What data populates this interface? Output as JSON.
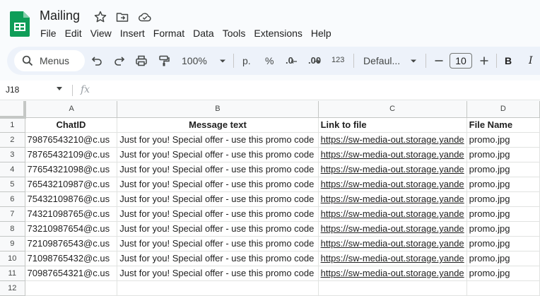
{
  "app": {
    "doc_title": "Mailing",
    "menu": [
      "File",
      "Edit",
      "View",
      "Insert",
      "Format",
      "Data",
      "Tools",
      "Extensions",
      "Help"
    ]
  },
  "toolbar": {
    "search_label": "Menus",
    "zoom": "100%",
    "currency_label": "p.",
    "percent_label": "%",
    "dec_decrease_label": ".0",
    "dec_increase_label": ".00",
    "number_format_label": "123",
    "font_name": "Defaul...",
    "font_size": "10",
    "bold_label": "B",
    "italic_label": "I"
  },
  "formula_bar": {
    "cell_ref": "J18",
    "fx_label": "fx",
    "content": ""
  },
  "sheet": {
    "columns": [
      "A",
      "B",
      "C",
      "D"
    ],
    "row_numbers": [
      "1",
      "2",
      "3",
      "4",
      "5",
      "6",
      "7",
      "8",
      "9",
      "10",
      "11",
      "12"
    ],
    "header": [
      "ChatID",
      "Message text",
      "Link to file",
      "File Name"
    ],
    "rows": [
      [
        "79876543210@c.us",
        "Just for you! Special offer - use this promo code",
        "https://sw-media-out.storage.yande",
        "promo.jpg"
      ],
      [
        "78765432109@c.us",
        "Just for you! Special offer - use this promo code",
        "https://sw-media-out.storage.yande",
        "promo.jpg"
      ],
      [
        "77654321098@c.us",
        "Just for you! Special offer - use this promo code",
        "https://sw-media-out.storage.yande",
        "promo.jpg"
      ],
      [
        "76543210987@c.us",
        "Just for you! Special offer - use this promo code",
        "https://sw-media-out.storage.yande",
        "promo.jpg"
      ],
      [
        "75432109876@c.us",
        "Just for you! Special offer - use this promo code",
        "https://sw-media-out.storage.yande",
        "promo.jpg"
      ],
      [
        "74321098765@c.us",
        "Just for you! Special offer - use this promo code",
        "https://sw-media-out.storage.yande",
        "promo.jpg"
      ],
      [
        "73210987654@c.us",
        "Just for you! Special offer - use this promo code",
        "https://sw-media-out.storage.yande",
        "promo.jpg"
      ],
      [
        "72109876543@c.us",
        "Just for you! Special offer - use this promo code",
        "https://sw-media-out.storage.yande",
        "promo.jpg"
      ],
      [
        "71098765432@c.us",
        "Just for you! Special offer - use this promo code",
        "https://sw-media-out.storage.yande",
        "promo.jpg"
      ],
      [
        "70987654321@c.us",
        "Just for you! Special offer - use this promo code",
        "https://sw-media-out.storage.yande",
        "promo.jpg"
      ]
    ]
  },
  "colors": {
    "sheets_green": "#0f9d58",
    "link_blue": "#1155cc",
    "toolbar_bg": "#edf2fa"
  }
}
